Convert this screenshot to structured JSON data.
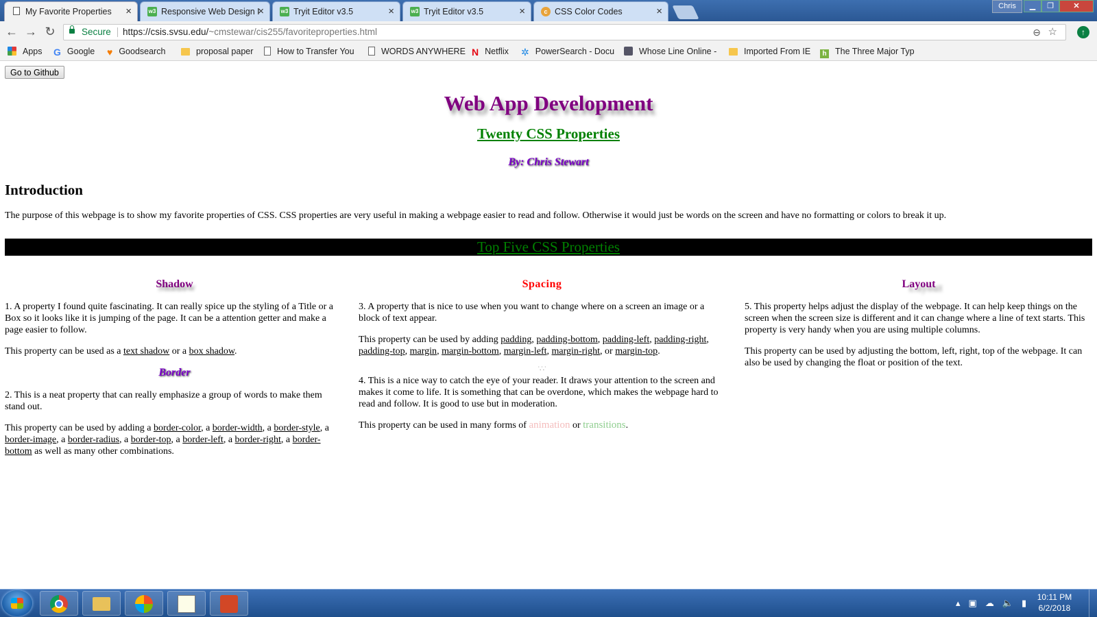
{
  "browser": {
    "tabs": [
      {
        "title": "My Favorite Properties",
        "favicon": "page-icon"
      },
      {
        "title": "Responsive Web Design I",
        "favicon": "w3schools-icon"
      },
      {
        "title": "Tryit Editor v3.5",
        "favicon": "w3schools-icon"
      },
      {
        "title": "Tryit Editor v3.5",
        "favicon": "w3schools-icon"
      },
      {
        "title": "CSS Color Codes",
        "favicon": "css-icon"
      }
    ],
    "close_glyph": "×",
    "user": "Chris",
    "secure_label": "Secure",
    "url_host": "https://csis.svsu.edu/",
    "url_path": "~cmstewar/cis255/favoriteproperties.html",
    "bookmarks": [
      {
        "label": "Apps",
        "icon": "apps-icon"
      },
      {
        "label": "Google",
        "icon": "google-icon"
      },
      {
        "label": "Goodsearch",
        "icon": "heart-icon"
      },
      {
        "label": "proposal paper",
        "icon": "folder-icon"
      },
      {
        "label": "How to Transfer You",
        "icon": "page-icon"
      },
      {
        "label": "WORDS ANYWHERE",
        "icon": "page-icon"
      },
      {
        "label": "Netflix",
        "icon": "netflix-icon"
      },
      {
        "label": "PowerSearch - Docu",
        "icon": "powersearch-icon"
      },
      {
        "label": "Whose Line Online -",
        "icon": "tv-icon"
      },
      {
        "label": "Imported From IE",
        "icon": "folder-icon"
      },
      {
        "label": "The Three Major Typ",
        "icon": "h-icon"
      }
    ]
  },
  "page": {
    "github_button": "Go to Github",
    "title": "Web App Development",
    "subtitle": "Twenty CSS Properties",
    "author": "By: Chris Stewart",
    "intro_heading": "Introduction",
    "intro_text": "The purpose of this webpage is to show my favorite properties of CSS. CSS properties are very useful in making a webpage easier to read and follow. Otherwise it would just be words on the screen and have no formatting or colors to break it up.",
    "top_five_heading": "Top Five CSS Properties",
    "shadow": {
      "heading": "Shadow",
      "description": "1. A property I found quite fascinating. It can really spice up the styling of a Title or a Box so it looks like it is jumping of the page. It can be a attention getter and make a page easier to follow.",
      "usage_prefix": "This property can be used as a ",
      "link_1": "text shadow",
      "or": " or a ",
      "link_2": "box shadow",
      "end": "."
    },
    "border": {
      "heading": "Border",
      "description": "2. This is a neat property that can really emphasize a group of words to make them stand out.",
      "usage_prefix": "This property can be used by adding a ",
      "links": [
        "border-color",
        "border-width",
        "border-style",
        "border-image",
        "border-radius",
        "border-top",
        "border-left",
        "border-right",
        "border-bottom"
      ],
      "sep_a": ", a ",
      "usage_suffix": " as well as many other combinations."
    },
    "spacing": {
      "heading": "Spacing",
      "description": "3. A property that is nice to use when you want to change where on a screen an image or a block of text appear.",
      "usage_prefix": "This property can be used by adding ",
      "links": [
        "padding",
        "padding-bottom",
        "padding-left",
        "padding-right",
        "padding-top",
        "margin",
        "margin-bottom",
        "margin-left",
        "margin-right",
        "margin-top"
      ],
      "sep": ", ",
      "sep_or": ", or ",
      "end": "."
    },
    "transitions": {
      "description": "4. This is a nice way to catch the eye of your reader. It draws your attention to the screen and makes it come to life. It is something that can be overdone, which makes the webpage hard to read and follow. It is good to use but in moderation.",
      "usage_prefix": "This property can be used in many forms of ",
      "word_1": "animation",
      "or": " or ",
      "word_2": "transitions",
      "end": "."
    },
    "layout": {
      "heading": "Layout",
      "description": "5. This property helps adjust the display of the webpage. It can help keep things on the screen when the screen size is different and it can change where a line of text starts. This property is very handy when you are using multiple columns.",
      "usage": "This property can be used by adjusting the bottom, left, right, top of the webpage. It can also be used by changing the float or position of the text."
    }
  },
  "taskbar": {
    "time": "10:11 PM",
    "date": "6/2/2018"
  },
  "colors": {
    "title": "#800080",
    "subtitle": "#008000",
    "spacing_heading": "#ff0000",
    "banner_bg": "#000000"
  }
}
